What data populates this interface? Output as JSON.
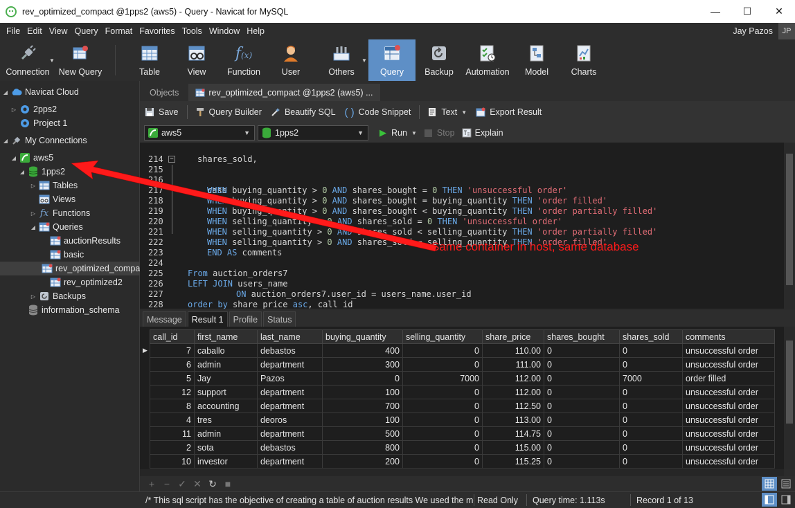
{
  "window": {
    "title": "rev_optimized_compact @1pps2 (aws5) - Query - Navicat for MySQL",
    "minimize": "—",
    "maximize": "☐",
    "close": "✕"
  },
  "menu": {
    "items": [
      "File",
      "Edit",
      "View",
      "Query",
      "Format",
      "Favorites",
      "Tools",
      "Window",
      "Help"
    ],
    "user_name": "Jay Pazos",
    "user_initials": "JP"
  },
  "toolbar": {
    "connection": "Connection",
    "new_query": "New Query",
    "table": "Table",
    "view": "View",
    "function": "Function",
    "user": "User",
    "others": "Others",
    "query": "Query",
    "backup": "Backup",
    "automation": "Automation",
    "model": "Model",
    "charts": "Charts"
  },
  "sidebar": {
    "navicat_cloud": "Navicat Cloud",
    "cloud_item_1": "2pps2",
    "cloud_item_2": "Project 1",
    "my_connections": "My Connections",
    "connection": "aws5",
    "database": "1pps2",
    "tables": "Tables",
    "views": "Views",
    "functions": "Functions",
    "queries": "Queries",
    "query_1": "auctionResults",
    "query_2": "basic",
    "query_3": "rev_optimized_compact",
    "query_4": "rev_optimized2",
    "backups": "Backups",
    "information_schema": "information_schema"
  },
  "tabs": {
    "objects": "Objects",
    "query_tab": "rev_optimized_compact @1pps2 (aws5) ..."
  },
  "query_toolbar": {
    "save": "Save",
    "query_builder": "Query Builder",
    "beautify": "Beautify SQL",
    "snippet": "Code Snippet",
    "text": "Text",
    "export": "Export Result"
  },
  "conn_bar": {
    "connection_value": "aws5",
    "database_value": "1pps2",
    "run": "Run",
    "stop": "Stop",
    "explain": "Explain"
  },
  "editor": {
    "lines": [
      {
        "n": "214",
        "code": "shares_sold,"
      },
      {
        "n": "215",
        "code": "case"
      },
      {
        "n": "216",
        "code": "WHEN buying_quantity > 0 AND shares_bought = 0 THEN 'unsuccessful order'"
      },
      {
        "n": "217",
        "code": "WHEN buying_quantity > 0 AND shares_bought = buying_quantity THEN 'order filled'"
      },
      {
        "n": "218",
        "code": "WHEN buying_quantity > 0 AND shares_bought < buying_quantity THEN 'order partially filled'"
      },
      {
        "n": "219",
        "code": "WHEN selling_quantity > 0 AND shares_sold = 0 THEN 'unsuccessful order'"
      },
      {
        "n": "220",
        "code": "WHEN selling_quantity > 0 AND shares_sold < selling_quantity THEN 'order partially filled'"
      },
      {
        "n": "221",
        "code": "WHEN selling_quantity > 0 AND shares_sold = selling_quantity THEN 'order filled'"
      },
      {
        "n": "222",
        "code": "END AS comments"
      },
      {
        "n": "223",
        "code": ""
      },
      {
        "n": "224",
        "code": "From auction_orders7"
      },
      {
        "n": "225",
        "code": "LEFT JOIN users_name"
      },
      {
        "n": "226",
        "code": "ON auction_orders7.user_id = users_name.user_id"
      },
      {
        "n": "227",
        "code": "order by share_price asc, call_id"
      },
      {
        "n": "228",
        "code": ""
      }
    ]
  },
  "result_tabs": [
    "Message",
    "Result 1",
    "Profile",
    "Status"
  ],
  "grid": {
    "columns": [
      "call_id",
      "first_name",
      "last_name",
      "buying_quantity",
      "selling_quantity",
      "share_price",
      "shares_bought",
      "shares_sold",
      "comments"
    ],
    "rows": [
      [
        "7",
        "caballo",
        "debastos",
        "400",
        "0",
        "110.00",
        "0",
        "0",
        "unsuccessful order"
      ],
      [
        "6",
        "admin",
        "department",
        "300",
        "0",
        "111.00",
        "0",
        "0",
        "unsuccessful order"
      ],
      [
        "5",
        "Jay",
        "Pazos",
        "0",
        "7000",
        "112.00",
        "0",
        "7000",
        "order filled"
      ],
      [
        "12",
        "support",
        "department",
        "100",
        "0",
        "112.00",
        "0",
        "0",
        "unsuccessful order"
      ],
      [
        "8",
        "accounting",
        "department",
        "700",
        "0",
        "112.50",
        "0",
        "0",
        "unsuccessful order"
      ],
      [
        "4",
        "tres",
        "deoros",
        "100",
        "0",
        "113.00",
        "0",
        "0",
        "unsuccessful order"
      ],
      [
        "11",
        "admin",
        "department",
        "500",
        "0",
        "114.75",
        "0",
        "0",
        "unsuccessful order"
      ],
      [
        "2",
        "sota",
        "debastos",
        "800",
        "0",
        "115.00",
        "0",
        "0",
        "unsuccessful order"
      ],
      [
        "10",
        "investor",
        "department",
        "200",
        "0",
        "115.25",
        "0",
        "0",
        "unsuccessful order"
      ]
    ]
  },
  "grid_toolbar": {
    "add": "+",
    "delete": "−",
    "apply": "✓",
    "discard": "✕",
    "refresh": "↻",
    "stop": "■"
  },
  "status": {
    "comment": "/* This sql script has the objective of creating a table of auction results We used the metho",
    "mode": "Read Only",
    "query_time": "Query time: 1.113s",
    "record": "Record 1 of 13"
  },
  "annotation": {
    "text": "Same container in host, same database",
    "color": "#ff1a1a"
  },
  "colors": {
    "accent": "#5e8fc6",
    "keyword": "#6aa9e8",
    "string": "#e06c75"
  }
}
